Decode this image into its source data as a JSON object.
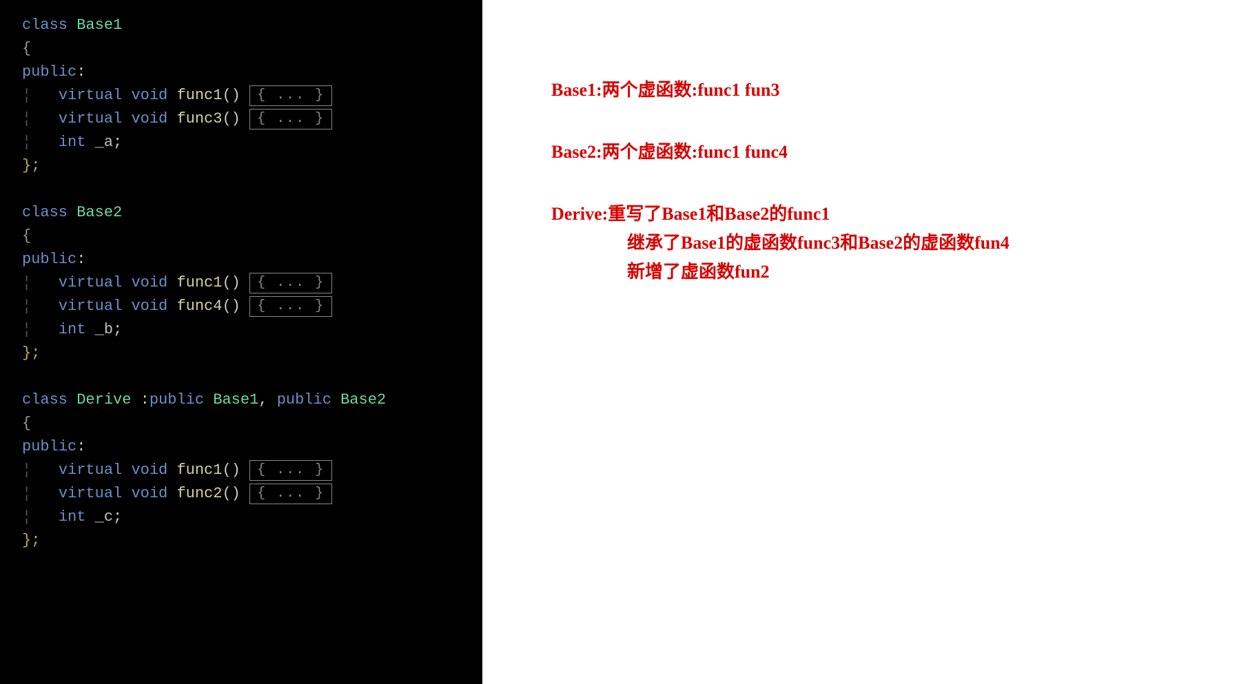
{
  "code": {
    "class_kw": "class",
    "public_kw": "public",
    "virtual_kw": "virtual",
    "void_kw": "void",
    "int_kw": "int",
    "open_brace": "{",
    "close_brace": "};",
    "colon": ":",
    "paren": "()",
    "fold_text": "{ ... }",
    "base1": {
      "name": "Base1",
      "func1": "func1",
      "func3": "func3",
      "member": "_a"
    },
    "base2": {
      "name": "Base2",
      "func1": "func1",
      "func4": "func4",
      "member": "_b"
    },
    "derive": {
      "name": "Derive",
      "inherit_prefix": " :",
      "inherit_sep": ", ",
      "base1_name": "Base1",
      "base2_name": "Base2",
      "func1": "func1",
      "func2": "func2",
      "member": "_c"
    }
  },
  "annotations": {
    "base1": "Base1:两个虚函数:func1 fun3",
    "base2": "Base2:两个虚函数:func1 func4",
    "derive_line1": "Derive:重写了Base1和Base2的func1",
    "derive_line2": "继承了Base1的虚函数func3和Base2的虚函数fun4",
    "derive_line3": "新增了虚函数fun2"
  }
}
